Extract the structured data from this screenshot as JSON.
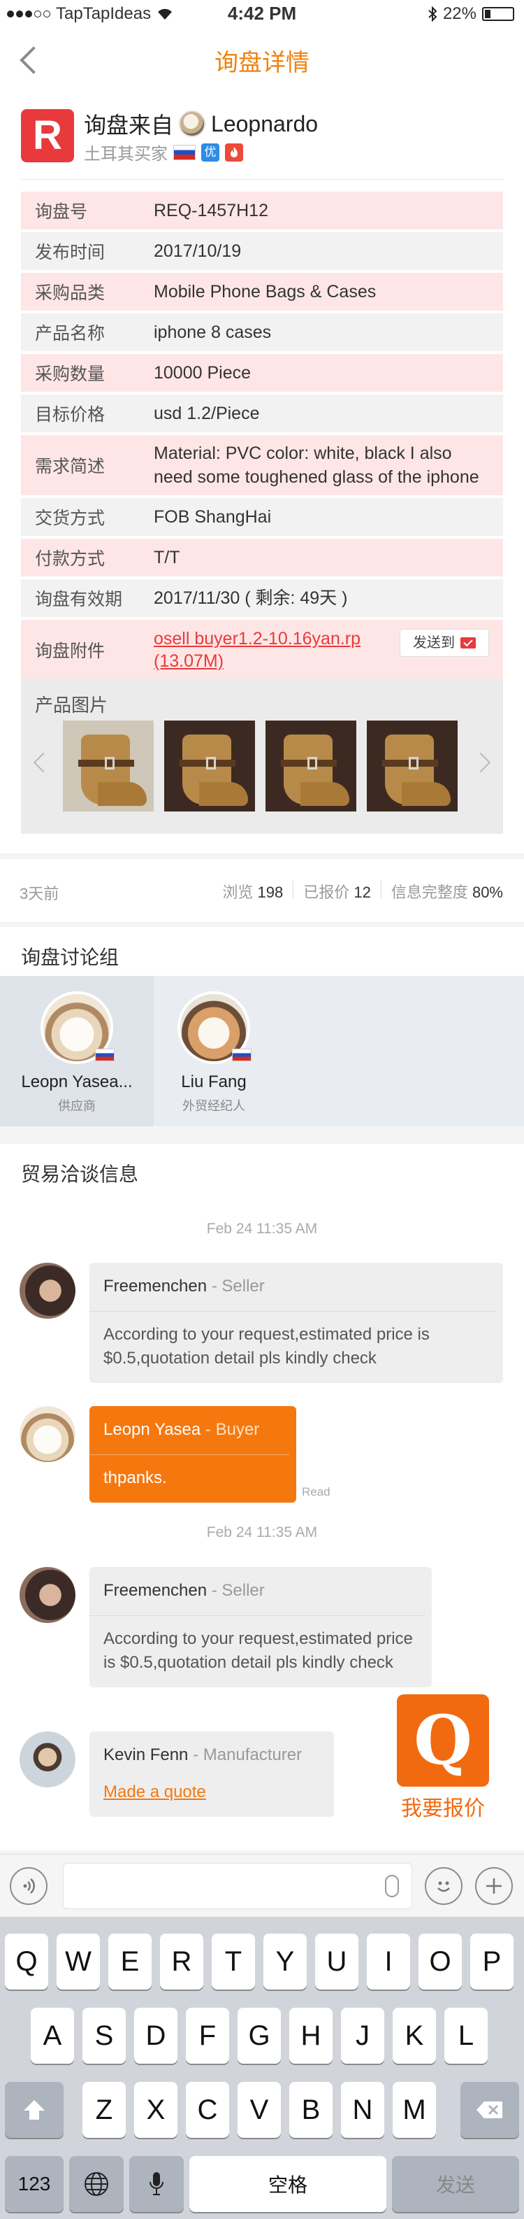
{
  "status": {
    "carrier": "TapTapIdeas",
    "time": "4:42 PM",
    "battery": "22%",
    "battery_level": 0.22
  },
  "nav": {
    "title": "询盘详情"
  },
  "header": {
    "from_label": "询盘来自",
    "user_name": "Leopnardo",
    "buyer_label": "土耳其买家",
    "badge_you": "优",
    "badge_fire": "火"
  },
  "info": {
    "rows": [
      {
        "key": "询盘号",
        "value": "REQ-1457H12"
      },
      {
        "key": "发布时间",
        "value": "2017/10/19"
      },
      {
        "key": "采购品类",
        "value": "Mobile Phone Bags & Cases"
      },
      {
        "key": "产品名称",
        "value": "iphone 8 cases"
      },
      {
        "key": "采购数量",
        "value": "10000 Piece"
      },
      {
        "key": "目标价格",
        "value": "usd 1.2/Piece"
      },
      {
        "key": "需求简述",
        "value": "Material: PVC color: white, black I also need some toughened glass of the iphone"
      },
      {
        "key": "交货方式",
        "value": "FOB ShangHai"
      },
      {
        "key": "付款方式",
        "value": "T/T"
      },
      {
        "key": "询盘有效期",
        "value": "2017/11/30 ( 剩余: 49天 )"
      }
    ],
    "attachment_key": "询盘附件",
    "attachment_file": "osell buyer1.2-10.16yan.rp (13.07M)",
    "send_to_label": "发送到",
    "photos_label": "产品图片"
  },
  "stats": {
    "ago": "3天前",
    "views_label": "浏览",
    "views": "198",
    "quoted_label": "已报价",
    "quoted": "12",
    "completeness_label": "信息完整度",
    "completeness": "80%"
  },
  "group": {
    "title": "询盘讨论组",
    "members": [
      {
        "name": "Leopn Yasea...",
        "role": "供应商"
      },
      {
        "name": "Liu Fang",
        "role": "外贸经纪人"
      }
    ]
  },
  "trade": {
    "title": "贸易洽谈信息",
    "timestamp1": "Feb 24 11:35 AM",
    "timestamp2": "Feb 24 11:35 AM",
    "messages": [
      {
        "name": "Freemenchen",
        "role": "- Seller",
        "text": "According to your request,estimated price is $0.5,quotation detail pls kindly check"
      },
      {
        "name": "Leopn Yasea",
        "role": "- Buyer",
        "text": "thpanks.",
        "status": "Read"
      },
      {
        "name": "Freemenchen",
        "role": "- Seller",
        "text": "According to your request,estimated price is $0.5,quotation detail pls kindly check"
      },
      {
        "name": "Kevin Fenn",
        "role": "- Manufacturer",
        "link": "Made a quote"
      }
    ],
    "quote_button_glyph": "Q",
    "quote_button_label": "我要报价"
  },
  "inputbar": {
    "voice_icon": "voice-icon",
    "emoji_icon": "emoji-icon",
    "plus_icon": "plus-icon"
  },
  "keyboard": {
    "row1": [
      "Q",
      "W",
      "E",
      "R",
      "T",
      "Y",
      "U",
      "I",
      "O",
      "P"
    ],
    "row2": [
      "A",
      "S",
      "D",
      "F",
      "G",
      "H",
      "J",
      "K",
      "L"
    ],
    "row3": [
      "Z",
      "X",
      "C",
      "V",
      "B",
      "N",
      "M"
    ],
    "num_key": "123",
    "space_key": "空格",
    "send_key": "发送"
  }
}
